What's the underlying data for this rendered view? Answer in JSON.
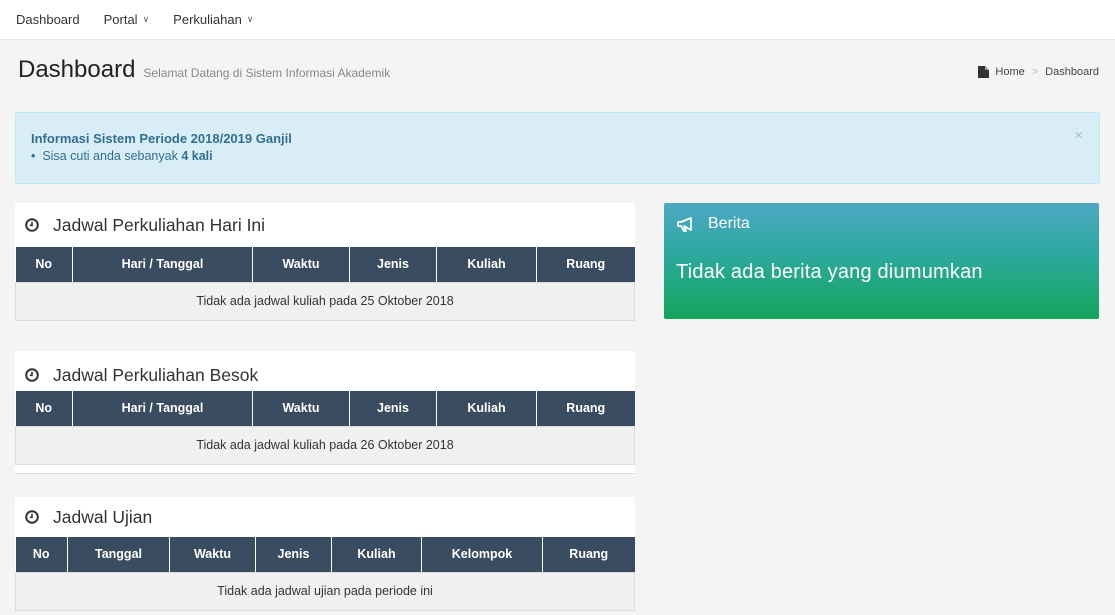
{
  "nav": {
    "dashboard": "Dashboard",
    "portal": "Portal",
    "perkuliahan": "Perkuliahan"
  },
  "header": {
    "title": "Dashboard",
    "subtitle": "Selamat Datang di Sistem Informasi Akademik"
  },
  "breadcrumb": {
    "home": "Home",
    "sep": ">",
    "current": "Dashboard"
  },
  "alert": {
    "title": "Informasi Sistem Periode 2018/2019 Ganjil",
    "prefix": "Sisa cuti anda sebanyak ",
    "count": "4 kali",
    "close": "×"
  },
  "today": {
    "title": "Jadwal Perkuliahan Hari Ini",
    "columns": [
      "No",
      "Hari / Tanggal",
      "Waktu",
      "Jenis",
      "Kuliah",
      "Ruang"
    ],
    "empty": "Tidak ada jadwal kuliah pada 25 Oktober 2018"
  },
  "tomorrow": {
    "title": "Jadwal Perkuliahan Besok",
    "columns": [
      "No",
      "Hari / Tanggal",
      "Waktu",
      "Jenis",
      "Kuliah",
      "Ruang"
    ],
    "empty": "Tidak ada jadwal kuliah pada 26 Oktober 2018"
  },
  "exam": {
    "title": "Jadwal Ujian",
    "columns": [
      "No",
      "Tanggal",
      "Waktu",
      "Jenis",
      "Kuliah",
      "Kelompok",
      "Ruang"
    ],
    "empty": "Tidak ada jadwal ujian pada periode ini"
  },
  "berita": {
    "title": "Berita",
    "message": "Tidak ada berita yang diumumkan"
  },
  "icons": {
    "clock": "clock-icon",
    "bullhorn": "bullhorn-icon",
    "doc": "document-icon",
    "caret": "chevron-down-icon"
  },
  "colors": {
    "table_header": "#3a4c5f",
    "alert_bg": "#d9edf7",
    "berita_top": "#4ea8c3",
    "berita_bottom": "#13a55a"
  }
}
